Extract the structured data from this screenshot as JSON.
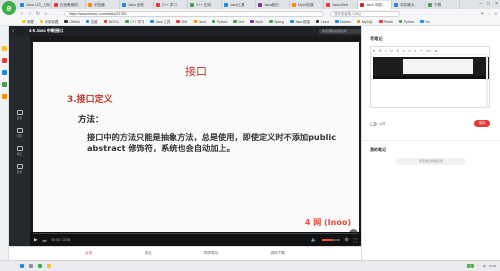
{
  "browser": {
    "tabs": [
      {
        "label": "Java 123_上网...",
        "color": "#1e88e5"
      },
      {
        "label": "在线教育的...",
        "color": "#e53935"
      },
      {
        "label": "浏览器",
        "color": "#fb8c00"
      },
      {
        "label": "Java 全栈",
        "color": "#1e88e5"
      },
      {
        "label": "C++ 学习",
        "color": "#e53935"
      },
      {
        "label": "C++ 在线",
        "color": "#43a047"
      },
      {
        "label": "Java工具",
        "color": "#1e88e5"
      },
      {
        "label": "Java知识",
        "color": "#8e24aa"
      },
      {
        "label": "MyUI知道",
        "color": "#fb8c00"
      },
      {
        "label": "Java Web",
        "color": "#e53935"
      },
      {
        "label": "Java 中国...",
        "color": "#c62828",
        "active": true
      },
      {
        "label": "浏览器大...",
        "color": "#1e88e5"
      },
      {
        "label": "下载",
        "color": "#43a047"
      }
    ],
    "url": "https://www.imooc.com/video/21765",
    "search_placeholder": "搜索或者输入网址",
    "bookmarks": [
      {
        "label": "收藏",
        "color": "#fbc02d"
      },
      {
        "label": "手机收藏",
        "color": "#fbc02d"
      },
      {
        "label": "GitHub",
        "color": "#333333"
      },
      {
        "label": "百度",
        "color": "#1e88e5"
      },
      {
        "label": "MOOC",
        "color": "#e53935"
      },
      {
        "label": "C++ 学习",
        "color": "#43a047"
      },
      {
        "label": "Java 工具",
        "color": "#1e88e5"
      },
      {
        "label": "JDK",
        "color": "#e53935"
      },
      {
        "label": "Java",
        "color": "#fb8c00"
      },
      {
        "label": "Python",
        "color": "#43a047"
      },
      {
        "label": "Vue",
        "color": "#43a047"
      },
      {
        "label": "MyUI",
        "color": "#8e24aa"
      },
      {
        "label": "Spring",
        "color": "#43a047"
      },
      {
        "label": "Java 框架",
        "color": "#1e88e5"
      },
      {
        "label": "Linux",
        "color": "#333333"
      },
      {
        "label": "Docker",
        "color": "#1e88e5"
      },
      {
        "label": "MySQL",
        "color": "#fb8c00"
      },
      {
        "label": "Redis",
        "color": "#e53935"
      },
      {
        "label": "Python",
        "color": "#43a047"
      },
      {
        "label": "Go",
        "color": "#1e88e5"
      }
    ]
  },
  "course": {
    "lesson_title": "4-5 Java 中断接口",
    "search_placeholder": "搜索课程/视频名称"
  },
  "rail": [
    {
      "label": "目录"
    },
    {
      "label": "问答"
    },
    {
      "label": "笔记"
    },
    {
      "label": "评论"
    }
  ],
  "slide": {
    "title": "接口",
    "section": "3.接口定义",
    "subhead": "方法：",
    "body": "接口中的方法只能是抽象方法，总是使用，即使定义时不添加public abstract 修饰符，系统也会自动加上。",
    "logo": "4 网 (Inoo)"
  },
  "player": {
    "time": "00:00 / 13:06",
    "progress": 0.0,
    "volume": 0.6
  },
  "bottom_tabs": [
    "目录",
    "评论",
    "同学笔记",
    "资料下载"
  ],
  "notes": {
    "title": "写笔记",
    "toolbar": [
      "H",
      "B",
      "I",
      "U",
      "S",
      "≡",
      "≡",
      "≡",
      "❝",
      "</>",
      "⧉"
    ],
    "public_label": "公开",
    "save_label": "保存",
    "my_notes_title": "我的笔记",
    "empty_text": "暂无笔记内容记录"
  },
  "taskbar": {
    "lang": "中",
    "time": "11:06",
    "badge": "上"
  }
}
